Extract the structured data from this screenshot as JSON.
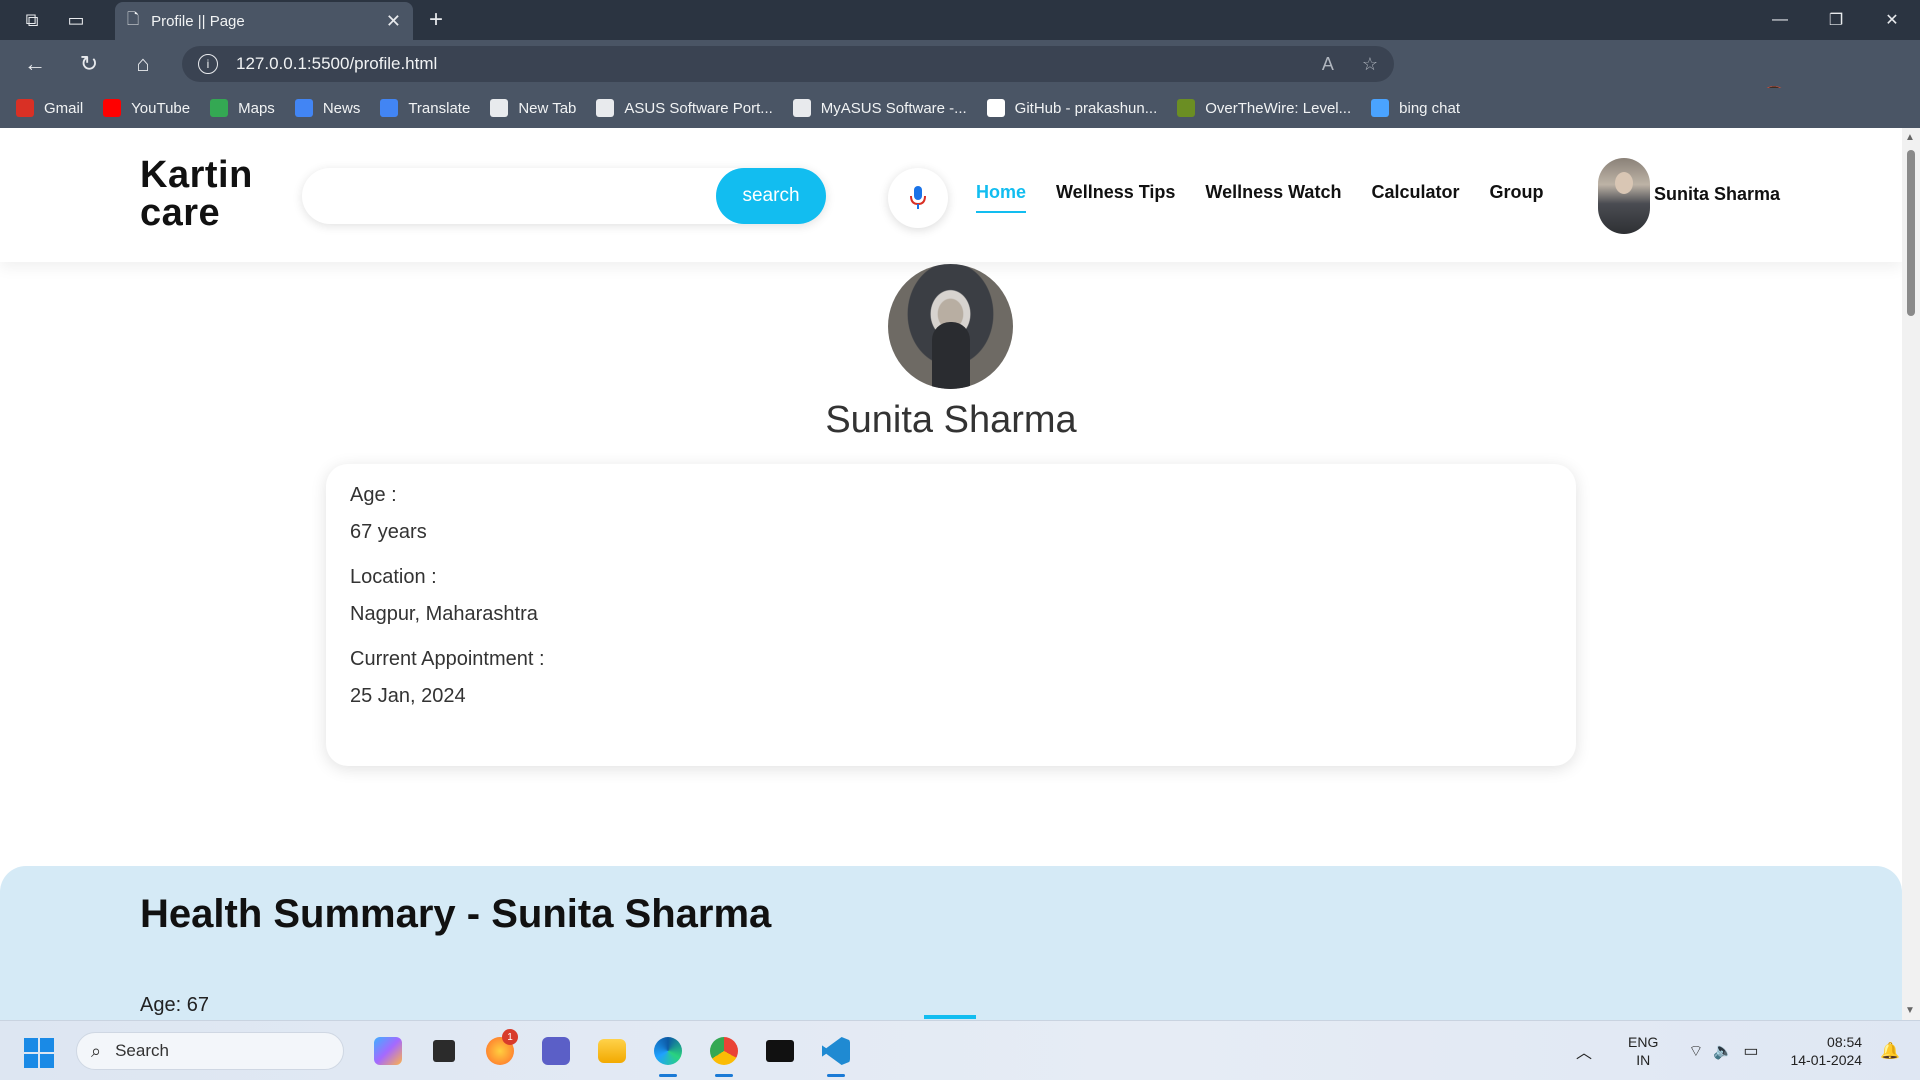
{
  "browser": {
    "tab_title": "Profile || Page",
    "url": "127.0.0.1:5500/profile.html",
    "bookmarks": [
      {
        "label": "Gmail",
        "icon": "gmail-icon",
        "color": "#d93025"
      },
      {
        "label": "YouTube",
        "icon": "youtube-icon",
        "color": "#ff0000"
      },
      {
        "label": "Maps",
        "icon": "maps-icon",
        "color": "#34a853"
      },
      {
        "label": "News",
        "icon": "news-icon",
        "color": "#4285f4"
      },
      {
        "label": "Translate",
        "icon": "translate-icon",
        "color": "#4285f4"
      },
      {
        "label": "New Tab",
        "icon": "page-icon",
        "color": "#e8eaed"
      },
      {
        "label": "ASUS Software Port...",
        "icon": "page-icon",
        "color": "#e8eaed"
      },
      {
        "label": "MyASUS Software -...",
        "icon": "page-icon",
        "color": "#e8eaed"
      },
      {
        "label": "GitHub - prakashun...",
        "icon": "github-icon",
        "color": "#ffffff"
      },
      {
        "label": "OverTheWire: Level...",
        "icon": "overthewire-icon",
        "color": "#6b8e23"
      },
      {
        "label": "bing chat",
        "icon": "search-icon",
        "color": "#4aa3ff"
      }
    ]
  },
  "site": {
    "logo": "Kartin care",
    "search": {
      "placeholder": "",
      "button": "search"
    },
    "nav": [
      {
        "label": "Home",
        "active": true
      },
      {
        "label": "Wellness Tips",
        "active": false
      },
      {
        "label": "Wellness Watch",
        "active": false
      },
      {
        "label": "Calculator",
        "active": false
      },
      {
        "label": "Group",
        "active": false
      }
    ],
    "user_name": "Sunita Sharma",
    "accent_color": "#12bdf0"
  },
  "profile": {
    "name": "Sunita Sharma",
    "fields": [
      {
        "label": "Age :",
        "value": "67 years"
      },
      {
        "label": "Location :",
        "value": "Nagpur, Maharashtra"
      },
      {
        "label": "Current Appointment :",
        "value": "25 Jan, 2024"
      }
    ]
  },
  "health_summary": {
    "title": "Health Summary - Sunita Sharma",
    "age_line": "Age: 67"
  },
  "taskbar": {
    "search_label": "Search",
    "notification_count": "1",
    "lang_line1": "ENG",
    "lang_line2": "IN",
    "time": "08:54",
    "date": "14-01-2024"
  }
}
